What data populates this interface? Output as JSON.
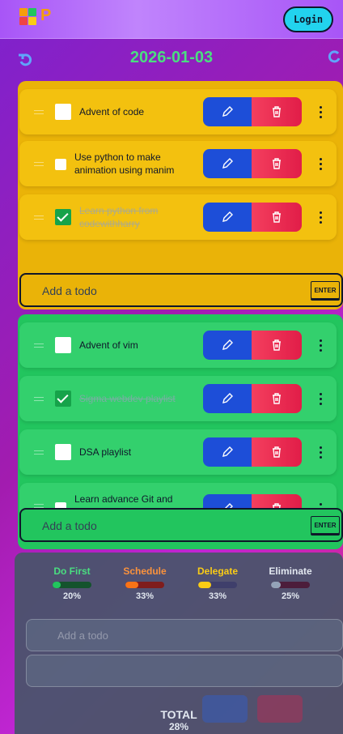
{
  "header": {
    "logo_text": "P",
    "login_label": "Login"
  },
  "date_nav": {
    "date": "2026-01-03",
    "undo_icon": "undo-icon",
    "redo_icon": "redo-icon"
  },
  "quadrants": [
    {
      "color": "#eab308",
      "todos": [
        {
          "text": "Advent of code",
          "checked": false
        },
        {
          "text": "Use python to make animation using manim",
          "checked": false
        },
        {
          "text": "Learn python from codewithharry",
          "checked": true
        }
      ],
      "add_placeholder": "Add a todo",
      "enter_label": "ENTER"
    },
    {
      "color": "#22c55e",
      "todos": [
        {
          "text": "Advent of vim",
          "checked": false
        },
        {
          "text": "Sigma webdev playlist",
          "checked": true
        },
        {
          "text": "DSA playlist",
          "checked": false
        },
        {
          "text": "Learn advance Git and",
          "checked": false
        }
      ],
      "add_placeholder": "Add a todo",
      "enter_label": "ENTER"
    }
  ],
  "stats": {
    "categories": [
      {
        "title": "Do First",
        "percent": "20%",
        "value": 20,
        "color": "#22c55e"
      },
      {
        "title": "Schedule",
        "percent": "33%",
        "value": 33,
        "color": "#f97316"
      },
      {
        "title": "Delegate",
        "percent": "33%",
        "value": 33,
        "color": "#facc15"
      },
      {
        "title": "Eliminate",
        "percent": "25%",
        "value": 25,
        "color": "#94a3b8"
      }
    ],
    "ghost_placeholder": "Add a todo",
    "total_label": "TOTAL",
    "total_percent": "28%"
  }
}
